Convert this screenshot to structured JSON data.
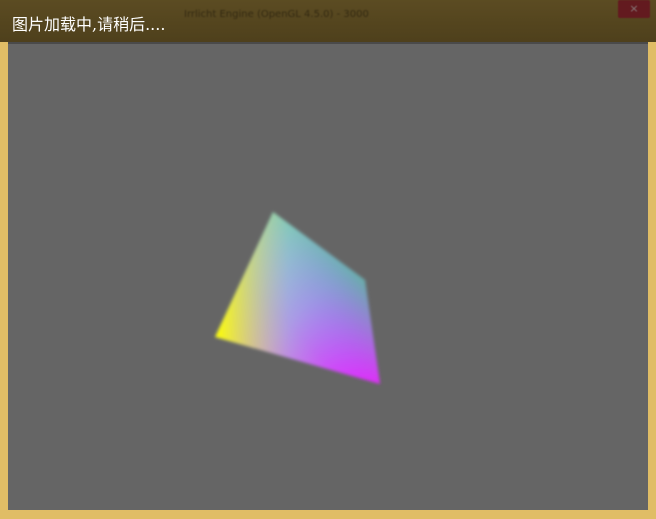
{
  "window": {
    "title": "Irrlicht Engine (OpenGL 4.5.0) - 3000",
    "close_label": "×"
  },
  "overlay": {
    "loading_text": "图片加载中,请稍后...."
  },
  "viewport": {
    "background_color": "#656565",
    "shape": "rgb-gradient-tetrahedron",
    "vertex_colors": [
      "#00ffff",
      "#00ff00",
      "#ff00ff",
      "#ffff00"
    ]
  }
}
